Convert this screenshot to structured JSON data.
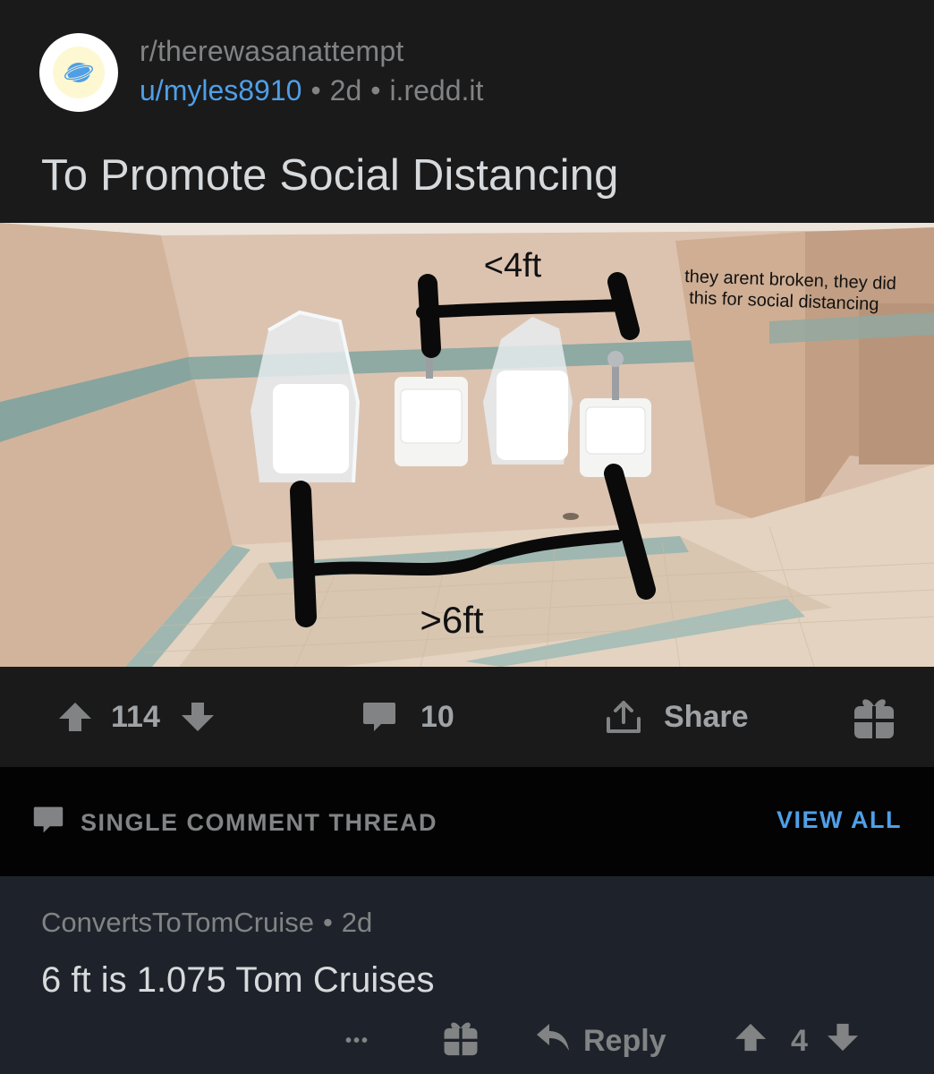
{
  "post": {
    "subreddit": "r/therewasanattempt",
    "author": "u/myles8910",
    "age": "2d",
    "domain": "i.redd.it",
    "separator": "•",
    "title": "To Promote Social Distancing",
    "image": {
      "annotation_top": "<4ft",
      "annotation_bottom": ">6ft",
      "caption_line1": "they arent broken, they did",
      "caption_line2": "this for social distancing"
    },
    "actions": {
      "score": "114",
      "comments": "10",
      "share_label": "Share"
    }
  },
  "thread_bar": {
    "label": "SINGLE COMMENT THREAD",
    "view_all": "VIEW ALL"
  },
  "comment": {
    "author": "ConvertsToTomCruise",
    "separator": "•",
    "age": "2d",
    "body": "6 ft is 1.075 Tom Cruises",
    "more": "•••",
    "reply_label": "Reply",
    "score": "4"
  },
  "colors": {
    "background": "#1a1a1b",
    "link_blue": "#4f9fe6",
    "muted": "#818384",
    "comment_bg": "#1e232b"
  }
}
